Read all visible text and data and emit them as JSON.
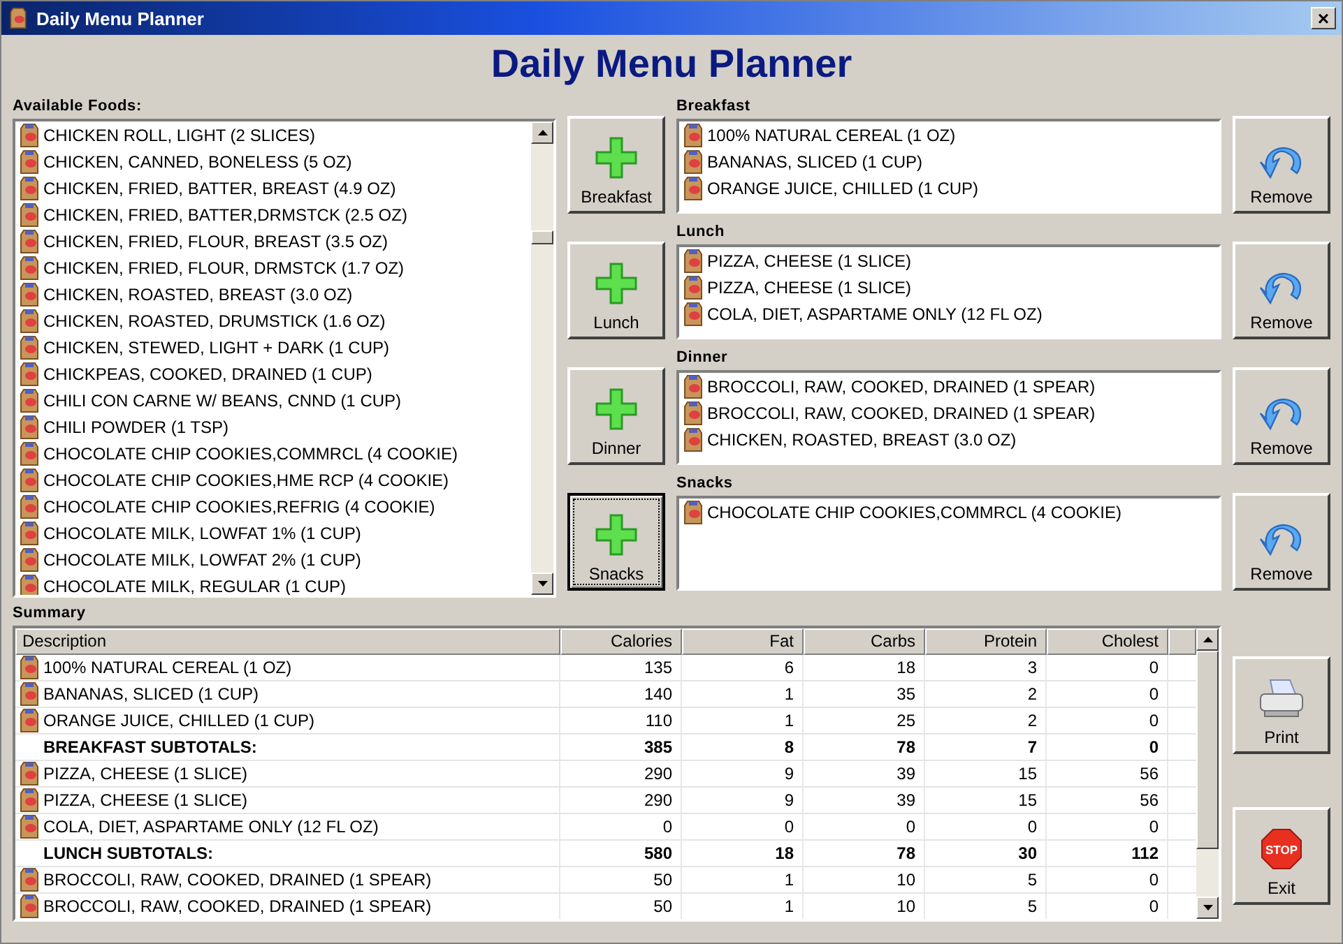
{
  "window": {
    "title": "Daily Menu Planner",
    "close": "×"
  },
  "heading": "Daily Menu Planner",
  "available_foods": {
    "label": "Available Foods:",
    "items": [
      "CHICKEN ROLL, LIGHT (2 SLICES)",
      "CHICKEN, CANNED, BONELESS (5 OZ)",
      "CHICKEN, FRIED, BATTER, BREAST (4.9 OZ)",
      "CHICKEN, FRIED, BATTER,DRMSTCK (2.5 OZ)",
      "CHICKEN, FRIED, FLOUR, BREAST (3.5 OZ)",
      "CHICKEN, FRIED, FLOUR, DRMSTCK (1.7 OZ)",
      "CHICKEN, ROASTED, BREAST (3.0 OZ)",
      "CHICKEN, ROASTED, DRUMSTICK (1.6 OZ)",
      "CHICKEN, STEWED, LIGHT + DARK (1 CUP)",
      "CHICKPEAS, COOKED, DRAINED (1 CUP)",
      "CHILI CON CARNE W/ BEANS, CNND (1 CUP)",
      "CHILI POWDER (1 TSP)",
      "CHOCOLATE CHIP COOKIES,COMMRCL (4 COOKIE)",
      "CHOCOLATE CHIP COOKIES,HME RCP (4 COOKIE)",
      "CHOCOLATE CHIP COOKIES,REFRIG (4 COOKIE)",
      "CHOCOLATE MILK, LOWFAT 1% (1 CUP)",
      "CHOCOLATE MILK, LOWFAT 2% (1 CUP)",
      "CHOCOLATE MILK, REGULAR (1 CUP)"
    ]
  },
  "meals": [
    {
      "label": "Breakfast",
      "add_button": "Breakfast",
      "focused": false,
      "remove_button": "Remove",
      "items": [
        "100% NATURAL CEREAL (1 OZ)",
        "BANANAS, SLICED (1 CUP)",
        "ORANGE JUICE, CHILLED (1 CUP)"
      ]
    },
    {
      "label": "Lunch",
      "add_button": "Lunch",
      "focused": false,
      "remove_button": "Remove",
      "items": [
        "PIZZA, CHEESE (1 SLICE)",
        "PIZZA, CHEESE (1 SLICE)",
        "COLA, DIET, ASPARTAME ONLY (12 FL OZ)"
      ]
    },
    {
      "label": "Dinner",
      "add_button": "Dinner",
      "focused": false,
      "remove_button": "Remove",
      "items": [
        "BROCCOLI, RAW, COOKED, DRAINED (1 SPEAR)",
        "BROCCOLI, RAW, COOKED, DRAINED (1 SPEAR)",
        "CHICKEN, ROASTED, BREAST (3.0 OZ)"
      ]
    },
    {
      "label": "Snacks",
      "add_button": "Snacks",
      "focused": true,
      "remove_button": "Remove",
      "items": [
        "CHOCOLATE CHIP COOKIES,COMMRCL (4 COOKIE)"
      ]
    }
  ],
  "summary": {
    "label": "Summary",
    "columns": [
      "Description",
      "Calories",
      "Fat",
      "Carbs",
      "Protein",
      "Cholest"
    ],
    "rows": [
      {
        "kind": "food",
        "cells": [
          "100% NATURAL CEREAL (1 OZ)",
          "135",
          "6",
          "18",
          "3",
          "0"
        ]
      },
      {
        "kind": "food",
        "cells": [
          "BANANAS, SLICED (1 CUP)",
          "140",
          "1",
          "35",
          "2",
          "0"
        ]
      },
      {
        "kind": "food",
        "cells": [
          "ORANGE JUICE, CHILLED (1 CUP)",
          "110",
          "1",
          "25",
          "2",
          "0"
        ]
      },
      {
        "kind": "subtotal",
        "cells": [
          "BREAKFAST SUBTOTALS:",
          "385",
          "8",
          "78",
          "7",
          "0"
        ]
      },
      {
        "kind": "food",
        "cells": [
          "PIZZA, CHEESE (1 SLICE)",
          "290",
          "9",
          "39",
          "15",
          "56"
        ]
      },
      {
        "kind": "food",
        "cells": [
          "PIZZA, CHEESE (1 SLICE)",
          "290",
          "9",
          "39",
          "15",
          "56"
        ]
      },
      {
        "kind": "food",
        "cells": [
          "COLA, DIET, ASPARTAME ONLY (12 FL OZ)",
          "0",
          "0",
          "0",
          "0",
          "0"
        ]
      },
      {
        "kind": "subtotal",
        "cells": [
          "LUNCH SUBTOTALS:",
          "580",
          "18",
          "78",
          "30",
          "112"
        ]
      },
      {
        "kind": "food",
        "cells": [
          "BROCCOLI, RAW, COOKED, DRAINED (1 SPEAR)",
          "50",
          "1",
          "10",
          "5",
          "0"
        ]
      },
      {
        "kind": "food",
        "cells": [
          "BROCCOLI, RAW, COOKED, DRAINED (1 SPEAR)",
          "50",
          "1",
          "10",
          "5",
          "0"
        ]
      }
    ]
  },
  "print_button": "Print",
  "exit_button": {
    "label": "Exit",
    "sign": "STOP"
  }
}
